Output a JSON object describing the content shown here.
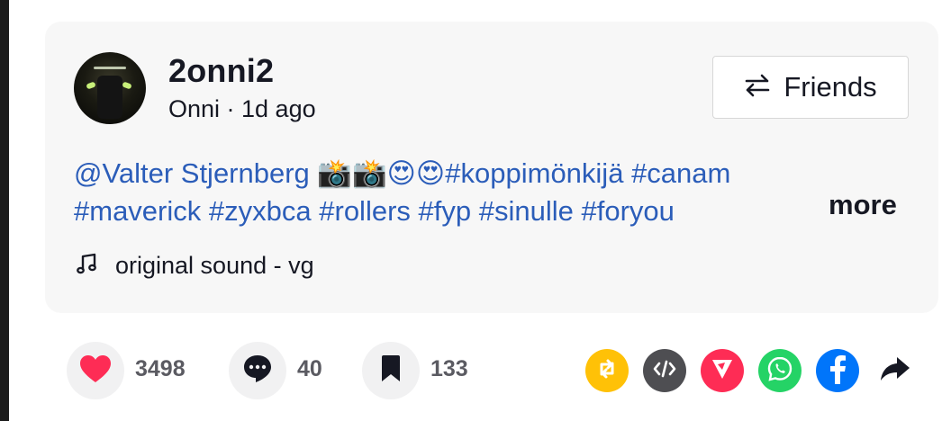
{
  "author": {
    "username": "2onni2",
    "subline": "Onni · 1d ago"
  },
  "follow_button": {
    "label": "Friends"
  },
  "caption": {
    "mention": "@Valter Stjernberg",
    "emojis": "📸📸😍😍",
    "line1_tags": [
      "#koppimönkijä",
      "#canam"
    ],
    "line2_tags": [
      "#maverick",
      "#zyxbca",
      "#rollers",
      "#fyp",
      "#sinulle",
      "#foryou"
    ],
    "more_label": "more"
  },
  "sound": {
    "label": "original sound - vg"
  },
  "actions": {
    "likes": "3498",
    "comments": "40",
    "saves": "133"
  },
  "share_targets": [
    {
      "icon": "repost-icon",
      "color": "#ffc107"
    },
    {
      "icon": "embed-code-icon",
      "color": "#4e4e52"
    },
    {
      "icon": "send-icon",
      "color": "#fe2c55"
    },
    {
      "icon": "whatsapp-icon",
      "color": "#25d366"
    },
    {
      "icon": "facebook-icon",
      "color": "#0075fa"
    },
    {
      "icon": "share-arrow-icon",
      "color": "#161823"
    }
  ],
  "colors": {
    "link": "#2b5db9",
    "like": "#fe2c55",
    "text": "#161823"
  }
}
